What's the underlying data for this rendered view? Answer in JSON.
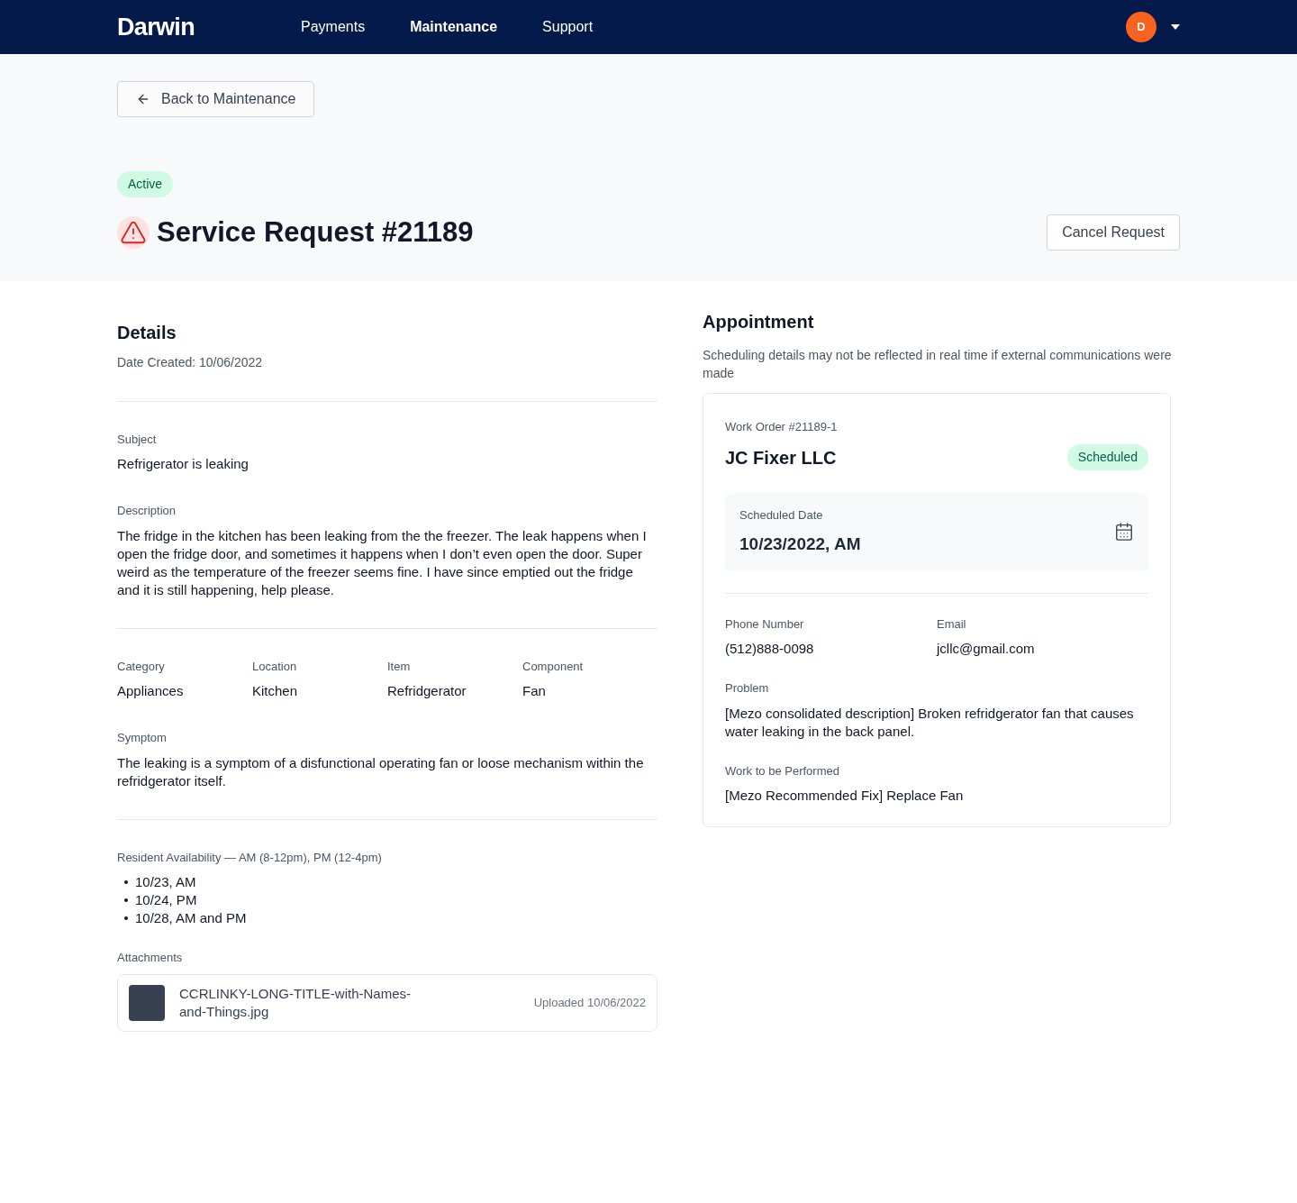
{
  "nav": {
    "logo": "Darwin",
    "items": [
      {
        "label": "Payments",
        "selected": false
      },
      {
        "label": "Maintenance",
        "selected": true
      },
      {
        "label": "Support",
        "selected": false
      }
    ],
    "avatar": "D"
  },
  "back_button": "Back to Maintenance",
  "status_badge": "Active",
  "title": "Service Request #21189",
  "cancel_button": "Cancel Request",
  "details": {
    "heading": "Details",
    "date_created": "Date Created: 10/06/2022",
    "subject": {
      "label": "Subject",
      "value": "Refrigerator is leaking"
    },
    "description": {
      "label": "Description",
      "value": "The fridge in the kitchen has been leaking from the the freezer. The leak happens when I open the fridge door, and sometimes it happens when I don’t even open the door. Super weird as the temperature of the freezer seems fine. I have since emptied out the fridge and it is still happening, help please."
    },
    "fields": [
      {
        "label": "Category",
        "value": "Appliances"
      },
      {
        "label": "Location",
        "value": "Kitchen"
      },
      {
        "label": "Item",
        "value": "Refridgerator"
      },
      {
        "label": "Component",
        "value": "Fan"
      }
    ],
    "symptom": {
      "label": "Symptom",
      "value": "The leaking is a symptom of a disfunctional operating fan or loose mechanism within the refridgerator itself."
    },
    "availability": {
      "label": "Resident Availability — AM (8-12pm), PM (12-4pm)",
      "items": [
        "10/23, AM",
        "10/24, PM",
        "10/28, AM and PM"
      ]
    },
    "attachments": {
      "label": "Attachments",
      "files": [
        {
          "name": "CCRLINKY-LONG-TITLE-with-Names-and-Things.jpg",
          "uploaded": "Uploaded 10/06/2022"
        }
      ]
    }
  },
  "appointment": {
    "heading": "Appointment",
    "note": "Scheduling details may not be reflected in real time if external communications were made",
    "work_order": "Work Order #21189-1",
    "vendor": "JC Fixer LLC",
    "status": "Scheduled",
    "scheduled_date": {
      "label": "Scheduled Date",
      "value": "10/23/2022, AM"
    },
    "contacts": [
      {
        "label": "Phone Number",
        "value": "(512)888-0098"
      },
      {
        "label": "Email",
        "value": "jcllc@gmail.com"
      }
    ],
    "problem": {
      "label": "Problem",
      "value": "[Mezo consolidated description] Broken refridgerator fan that causes water leaking in the back panel."
    },
    "work": {
      "label": "Work to be Performed",
      "value": "[Mezo Recommended Fix] Replace Fan"
    }
  }
}
